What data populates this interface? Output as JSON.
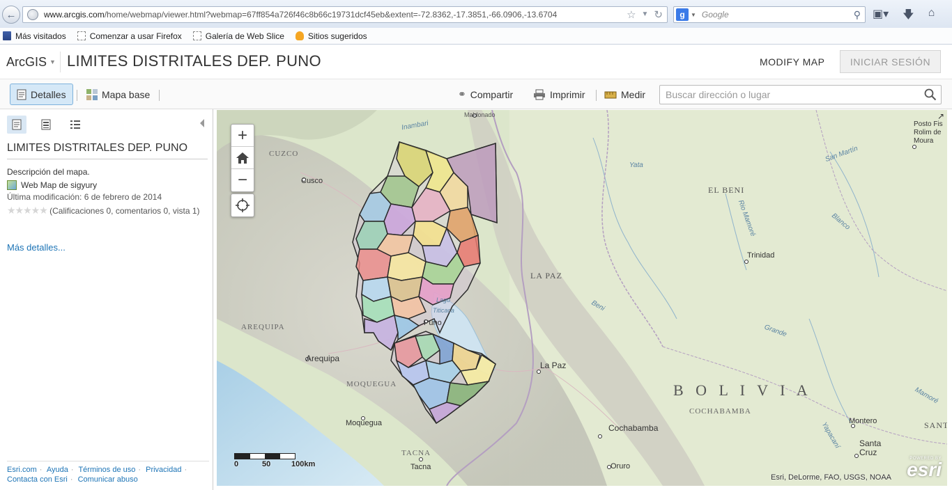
{
  "browser": {
    "url_host": "www.arcgis.com",
    "url_rest": "/home/webmap/viewer.html?webmap=67ff854a726f46c8b66c19731dcf45eb&extent=-72.8362,-17.3851,-66.0906,-13.6704",
    "search_engine_placeholder": "Google",
    "bookmarks": [
      "Más visitados",
      "Comenzar a usar Firefox",
      "Galería de Web Slice",
      "Sitios sugeridos"
    ]
  },
  "header": {
    "app_name": "ArcGIS",
    "map_title": "LIMITES DISTRITALES DEP. PUNO",
    "modify_map": "MODIFY MAP",
    "sign_in": "INICIAR SESIÓN"
  },
  "toolbar": {
    "details": "Detalles",
    "basemap": "Mapa base",
    "share": "Compartir",
    "print": "Imprimir",
    "measure": "Medir",
    "search_placeholder": "Buscar dirección o lugar"
  },
  "panel": {
    "title": "LIMITES DISTRITALES DEP. PUNO",
    "description": "Descripción del mapa.",
    "owner_prefix": "Web Map de",
    "owner": "sigyury",
    "modified": "Última modificación: 6 de febrero de 2014",
    "rating_text": "(Calificaciones 0, comentarios 0, vista 1)",
    "more_details": "Más detalles...",
    "footer": [
      "Esri.com",
      "Ayuda",
      "Términos de uso",
      "Privacidad",
      "Contacta con Esri",
      "Comunicar abuso"
    ]
  },
  "map": {
    "zoom_in": "+",
    "zoom_out": "−",
    "scale_labels": [
      "0",
      "50",
      "100km"
    ],
    "attribution": "Esri, DeLorme, FAO, USGS, NOAA",
    "esri_powered": "POWERED BY",
    "esri_word": "esri",
    "labels": {
      "cuzco_region": "CUZCO",
      "cusco": "Cusco",
      "arequipa_region": "AREQUIPA",
      "arequipa": "Arequipa",
      "moquegua_region": "MOQUEGUA",
      "moquegua": "Moquegua",
      "tacna_region": "TACNA",
      "tacna": "Tacna",
      "puno": "Puno",
      "la_paz_region": "LA PAZ",
      "la_paz": "La Paz",
      "el_beni": "EL BENI",
      "trinidad": "Trinidad",
      "bolivia": "B O L I V I A",
      "cochabamba_region": "COCHABAMBA",
      "cochabamba": "Cochabamba",
      "oruro": "Oruro",
      "montero": "Montero",
      "santa_cruz": "Santa Cruz",
      "santa_partial": "SANT",
      "maldonado": "Maldonado",
      "inambari": "Inambari",
      "yata": "Yata",
      "rio_mamore": "Rio Mamoré",
      "san_martin": "San Martín",
      "blanco": "Blanco",
      "beni_river": "Beni",
      "grande": "Grande",
      "yapacani": "Yapacaní",
      "mamore_right": "Mamoré",
      "lago": "Lago",
      "titicaca": "Titicaca",
      "posto": "Posto Fis",
      "rolim": "Rolim de",
      "moura": "Moura"
    }
  },
  "colors": {
    "accent": "#1d74b6",
    "details_active_bg": "#d5e8f7",
    "district_border": "#2b2b2b",
    "lake": "#cfe3ef"
  }
}
